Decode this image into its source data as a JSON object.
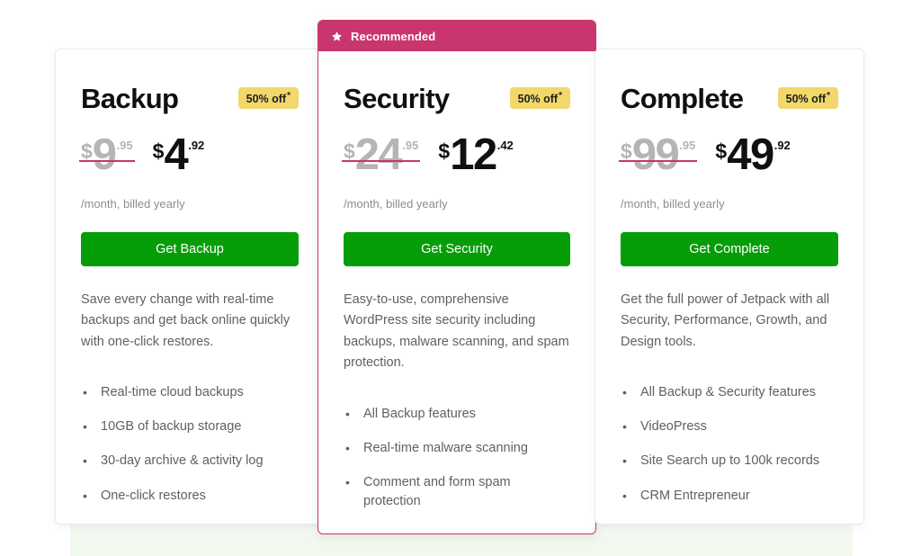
{
  "colors": {
    "accent_pink": "#c9356e",
    "cta_green": "#069e08",
    "badge_yellow": "#f2d76b",
    "body_text": "#5f5f66",
    "old_price_grey": "#b5b5b5"
  },
  "ribbon": {
    "label": "Recommended",
    "star_icon": "star-icon"
  },
  "plans": [
    {
      "id": "backup",
      "title": "Backup",
      "badge": "50% off",
      "badge_asterisk": "*",
      "old_price": {
        "currency": "$",
        "amount": "9",
        "cents": ".95"
      },
      "new_price": {
        "currency": "$",
        "amount": "4",
        "cents": ".92"
      },
      "billing_note": "/month, billed yearly",
      "cta_label": "Get Backup",
      "description": "Save every change with real-time backups and get back online quickly with one-click restores.",
      "features": [
        "Real-time cloud backups",
        "10GB of backup storage",
        "30-day archive & activity log",
        "One-click restores"
      ]
    },
    {
      "id": "security",
      "title": "Security",
      "badge": "50% off",
      "badge_asterisk": "*",
      "old_price": {
        "currency": "$",
        "amount": "24",
        "cents": ".95"
      },
      "new_price": {
        "currency": "$",
        "amount": "12",
        "cents": ".42"
      },
      "billing_note": "/month, billed yearly",
      "cta_label": "Get Security",
      "description": "Easy-to-use, comprehensive WordPress site security including backups, malware scanning, and spam protection.",
      "features": [
        "All Backup features",
        "Real-time malware scanning",
        "Comment and form spam protection"
      ]
    },
    {
      "id": "complete",
      "title": "Complete",
      "badge": "50% off",
      "badge_asterisk": "*",
      "old_price": {
        "currency": "$",
        "amount": "99",
        "cents": ".95"
      },
      "new_price": {
        "currency": "$",
        "amount": "49",
        "cents": ".92"
      },
      "billing_note": "/month, billed yearly",
      "cta_label": "Get Complete",
      "description": "Get the full power of Jetpack with all Security, Performance, Growth, and Design tools.",
      "features": [
        "All Backup & Security features",
        "VideoPress",
        "Site Search up to 100k records",
        "CRM Entrepreneur"
      ]
    }
  ]
}
